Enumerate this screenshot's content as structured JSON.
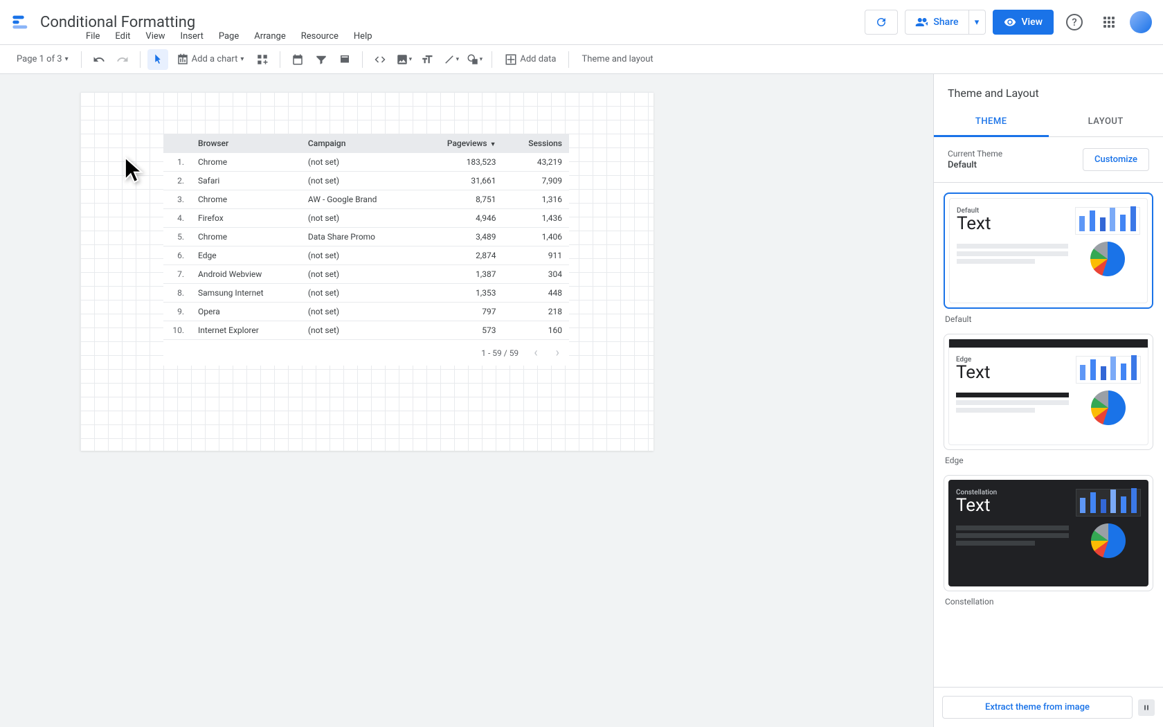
{
  "header": {
    "title": "Conditional Formatting",
    "share": "Share",
    "view": "View"
  },
  "menu": [
    "File",
    "Edit",
    "View",
    "Insert",
    "Page",
    "Arrange",
    "Resource",
    "Help"
  ],
  "toolbar": {
    "page_indicator": "Page 1 of 3",
    "add_chart": "Add a chart",
    "add_data": "Add data",
    "theme_layout": "Theme and layout"
  },
  "table": {
    "headers": [
      "",
      "Browser",
      "Campaign",
      "Pageviews",
      "Sessions"
    ],
    "sort_col": "Pageviews",
    "rows": [
      {
        "n": "1.",
        "browser": "Chrome",
        "campaign": "(not set)",
        "pageviews": "183,523",
        "sessions": "43,219"
      },
      {
        "n": "2.",
        "browser": "Safari",
        "campaign": "(not set)",
        "pageviews": "31,661",
        "sessions": "7,909"
      },
      {
        "n": "3.",
        "browser": "Chrome",
        "campaign": "AW - Google Brand",
        "pageviews": "8,751",
        "sessions": "1,316"
      },
      {
        "n": "4.",
        "browser": "Firefox",
        "campaign": "(not set)",
        "pageviews": "4,946",
        "sessions": "1,436"
      },
      {
        "n": "5.",
        "browser": "Chrome",
        "campaign": "Data Share Promo",
        "pageviews": "3,489",
        "sessions": "1,406"
      },
      {
        "n": "6.",
        "browser": "Edge",
        "campaign": "(not set)",
        "pageviews": "2,874",
        "sessions": "911"
      },
      {
        "n": "7.",
        "browser": "Android Webview",
        "campaign": "(not set)",
        "pageviews": "1,387",
        "sessions": "304"
      },
      {
        "n": "8.",
        "browser": "Samsung Internet",
        "campaign": "(not set)",
        "pageviews": "1,353",
        "sessions": "448"
      },
      {
        "n": "9.",
        "browser": "Opera",
        "campaign": "(not set)",
        "pageviews": "797",
        "sessions": "218"
      },
      {
        "n": "10.",
        "browser": "Internet Explorer",
        "campaign": "(not set)",
        "pageviews": "573",
        "sessions": "160"
      }
    ],
    "pagination": "1 - 59 / 59"
  },
  "panel": {
    "title": "Theme and Layout",
    "tabs": {
      "theme": "THEME",
      "layout": "LAYOUT"
    },
    "current_label": "Current Theme",
    "current_name": "Default",
    "customize": "Customize",
    "themes": [
      {
        "name": "Default",
        "label": "Default",
        "text": "Text",
        "selected": true,
        "style": "light"
      },
      {
        "name": "Edge",
        "label": "Edge",
        "text": "Text",
        "selected": false,
        "style": "edge"
      },
      {
        "name": "Constellation",
        "label": "Constellation",
        "text": "Text",
        "selected": false,
        "style": "dark"
      }
    ],
    "extract": "Extract theme from image"
  }
}
